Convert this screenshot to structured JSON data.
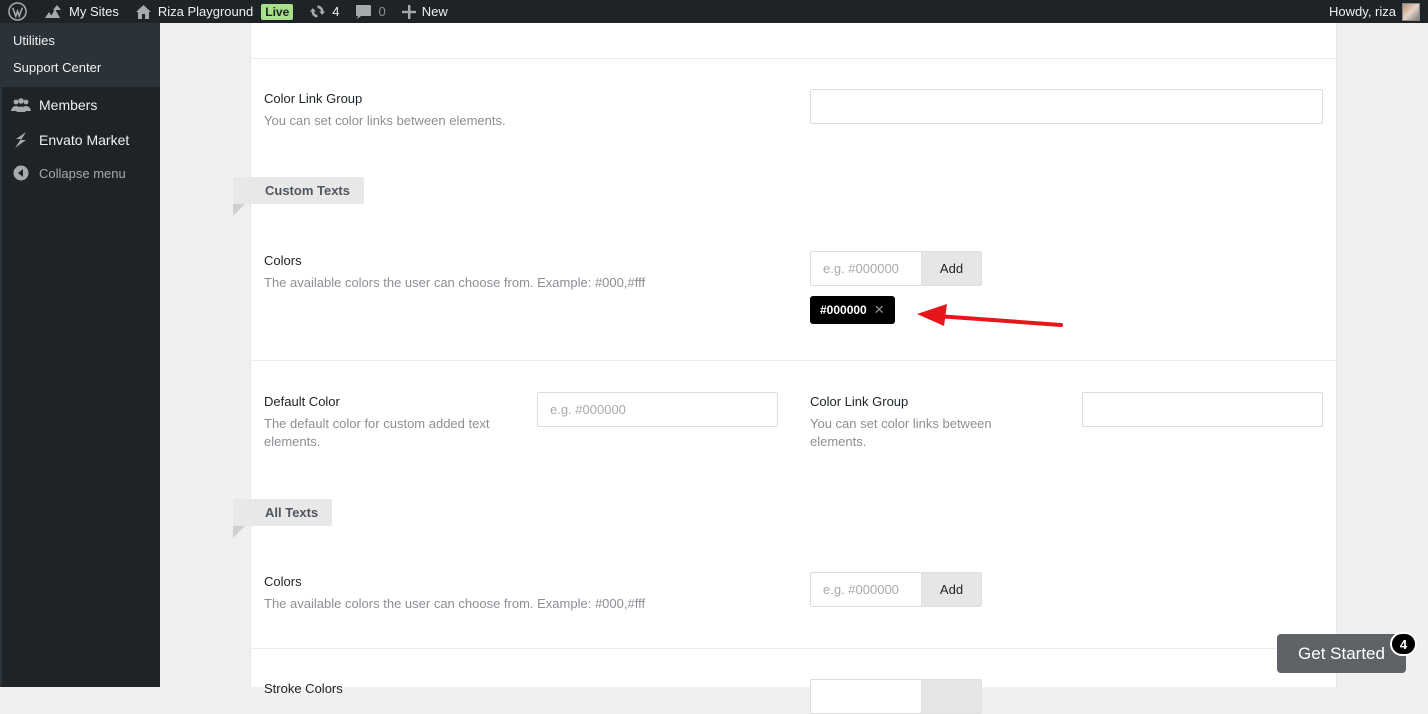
{
  "adminbar": {
    "my_sites": "My Sites",
    "site_name": "Riza Playground",
    "live_badge": "Live",
    "updates_count": "4",
    "comments_count": "0",
    "new_label": "New",
    "howdy": "Howdy, riza"
  },
  "sidebar": {
    "submenu": [
      "Utilities",
      "Support Center"
    ],
    "members": "Members",
    "envato": "Envato Market",
    "collapse": "Collapse menu"
  },
  "rows": {
    "link_group_top": {
      "title": "Color Link Group",
      "desc": "You can set color links between elements."
    },
    "custom_texts": {
      "tag": "Custom Texts",
      "colors_title": "Colors",
      "colors_desc": "The available colors the user can choose from. Example: #000,#fff",
      "placeholder": "e.g. #000000",
      "add_label": "Add",
      "chip_label": "#000000",
      "chip_remove": "✕"
    },
    "defaults": {
      "default_title": "Default Color",
      "default_desc": "The default color for custom added text elements.",
      "default_placeholder": "e.g. #000000",
      "link_title": "Color Link Group",
      "link_desc": "You can set color links between elements."
    },
    "all_texts": {
      "tag": "All Texts",
      "colors_title": "Colors",
      "colors_desc": "The available colors the user can choose from. Example: #000,#fff",
      "placeholder": "e.g. #000000",
      "add_label": "Add"
    },
    "stroke": {
      "title": "Stroke Colors"
    }
  },
  "get_started": {
    "label": "Get Started",
    "badge": "4"
  },
  "colors": {
    "arrow": "#e8161b",
    "chip_bg": "#000000"
  }
}
